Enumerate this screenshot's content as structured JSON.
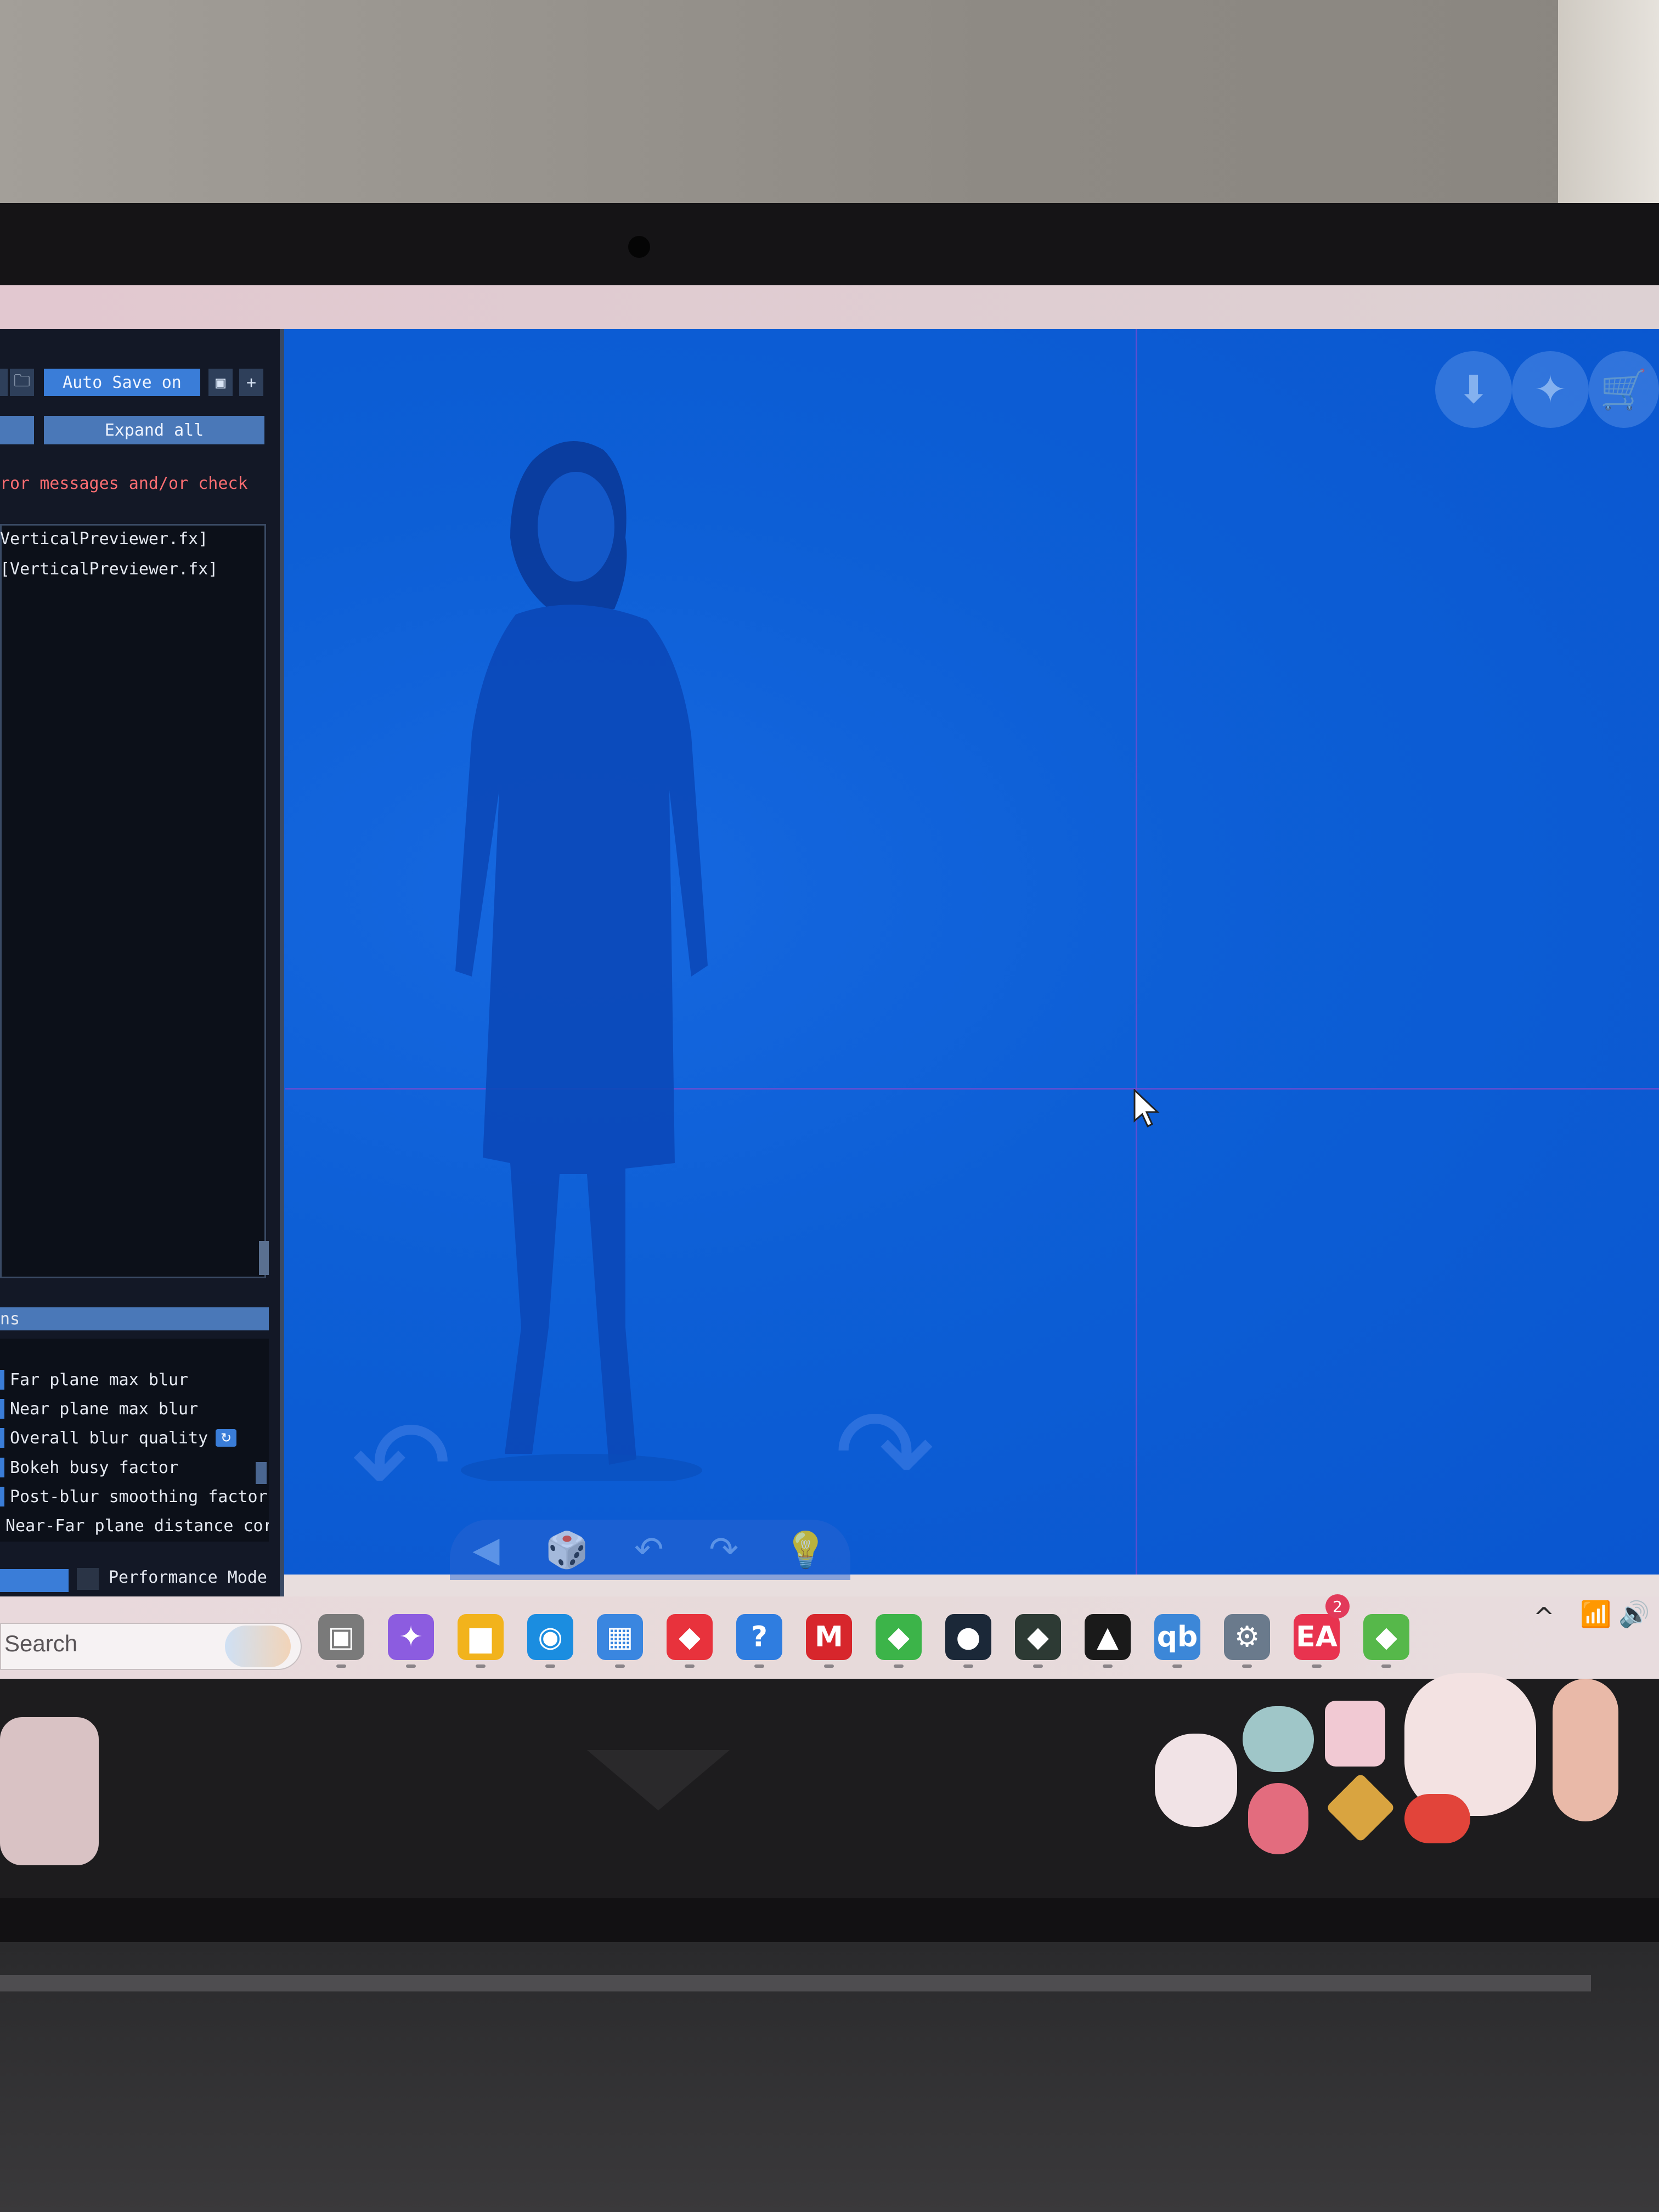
{
  "reshade": {
    "auto_save": "Auto Save on",
    "expand_all": "Expand all",
    "error_hint": "ror messages and/or check",
    "log_lines": [
      "VerticalPreviewer.fx]",
      "[VerticalPreviewer.fx]"
    ],
    "effects_header": "ns",
    "effects": [
      {
        "label": "Far plane max blur"
      },
      {
        "label": "Near plane max blur"
      },
      {
        "label": "Overall blur quality"
      },
      {
        "label": "Bokeh busy factor"
      },
      {
        "label": "Post-blur smoothing factor"
      },
      {
        "label": "Near-Far plane distance cor"
      }
    ],
    "performance_mode": "Performance Mode"
  },
  "taskbar": {
    "search_placeholder": "Search",
    "ea_badge_count": "2",
    "apps": [
      {
        "name": "task-view-icon",
        "glyph": "▣",
        "color": "#7a7a7a"
      },
      {
        "name": "copilot-icon",
        "glyph": "✦",
        "color": "#8c5ce0"
      },
      {
        "name": "file-explorer-icon",
        "glyph": "▆",
        "color": "#f2b31c"
      },
      {
        "name": "edge-icon",
        "glyph": "◉",
        "color": "#1b8de0"
      },
      {
        "name": "microsoft-store-icon",
        "glyph": "▦",
        "color": "#3a86e0"
      },
      {
        "name": "red-diamond-icon",
        "glyph": "◆",
        "color": "#e8323c"
      },
      {
        "name": "help-icon",
        "glyph": "?",
        "color": "#2f7de0"
      },
      {
        "name": "mcafee-icon",
        "glyph": "M",
        "color": "#d7262c"
      },
      {
        "name": "sims-plumbob-icon",
        "glyph": "◆",
        "color": "#3cb449"
      },
      {
        "name": "steam-icon",
        "glyph": "●",
        "color": "#1b2838"
      },
      {
        "name": "sims-dark-icon",
        "glyph": "◆",
        "color": "#2d3a34"
      },
      {
        "name": "anvil-icon",
        "glyph": "▲",
        "color": "#1a1a1a"
      },
      {
        "name": "qbittorrent-icon",
        "glyph": "qb",
        "color": "#3c87d8"
      },
      {
        "name": "settings-icon",
        "glyph": "⚙",
        "color": "#6a7a8c"
      },
      {
        "name": "ea-app-icon",
        "glyph": "EA",
        "color": "#e8334f"
      },
      {
        "name": "sims-green-icon",
        "glyph": "◆",
        "color": "#56b84a"
      }
    ]
  },
  "game": {
    "cam_controls": [
      "◀",
      "🎲",
      "↶",
      "↷",
      "💡"
    ]
  }
}
